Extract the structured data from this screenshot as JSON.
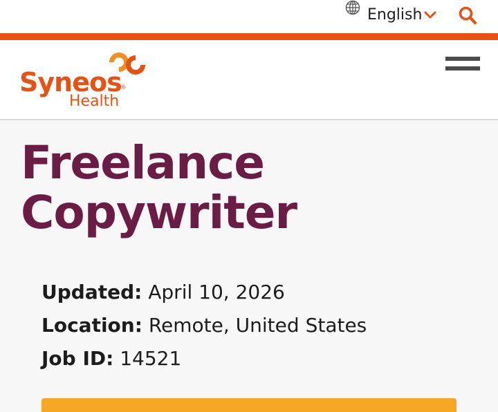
{
  "colors": {
    "accent": "#e85111",
    "title": "#6a1c45",
    "logo_orange": "#f08f1f",
    "apply_button": "#f5a623"
  },
  "top_bar": {
    "language_icon": "globe-icon",
    "language": "English",
    "language_chevron_icon": "chevron-down-icon",
    "search_icon": "search-icon"
  },
  "header": {
    "logo": {
      "word": "Syneos",
      "registered_mark": "®",
      "sub": "Health"
    },
    "menu_icon": "hamburger-menu-icon"
  },
  "job": {
    "title": "Freelance Copywriter",
    "updated_label": "Updated:",
    "updated_value": "April 10, 2026",
    "location_label": "Location:",
    "location_value": "Remote, United States",
    "job_id_label": "Job ID:",
    "job_id_value": "14521"
  }
}
